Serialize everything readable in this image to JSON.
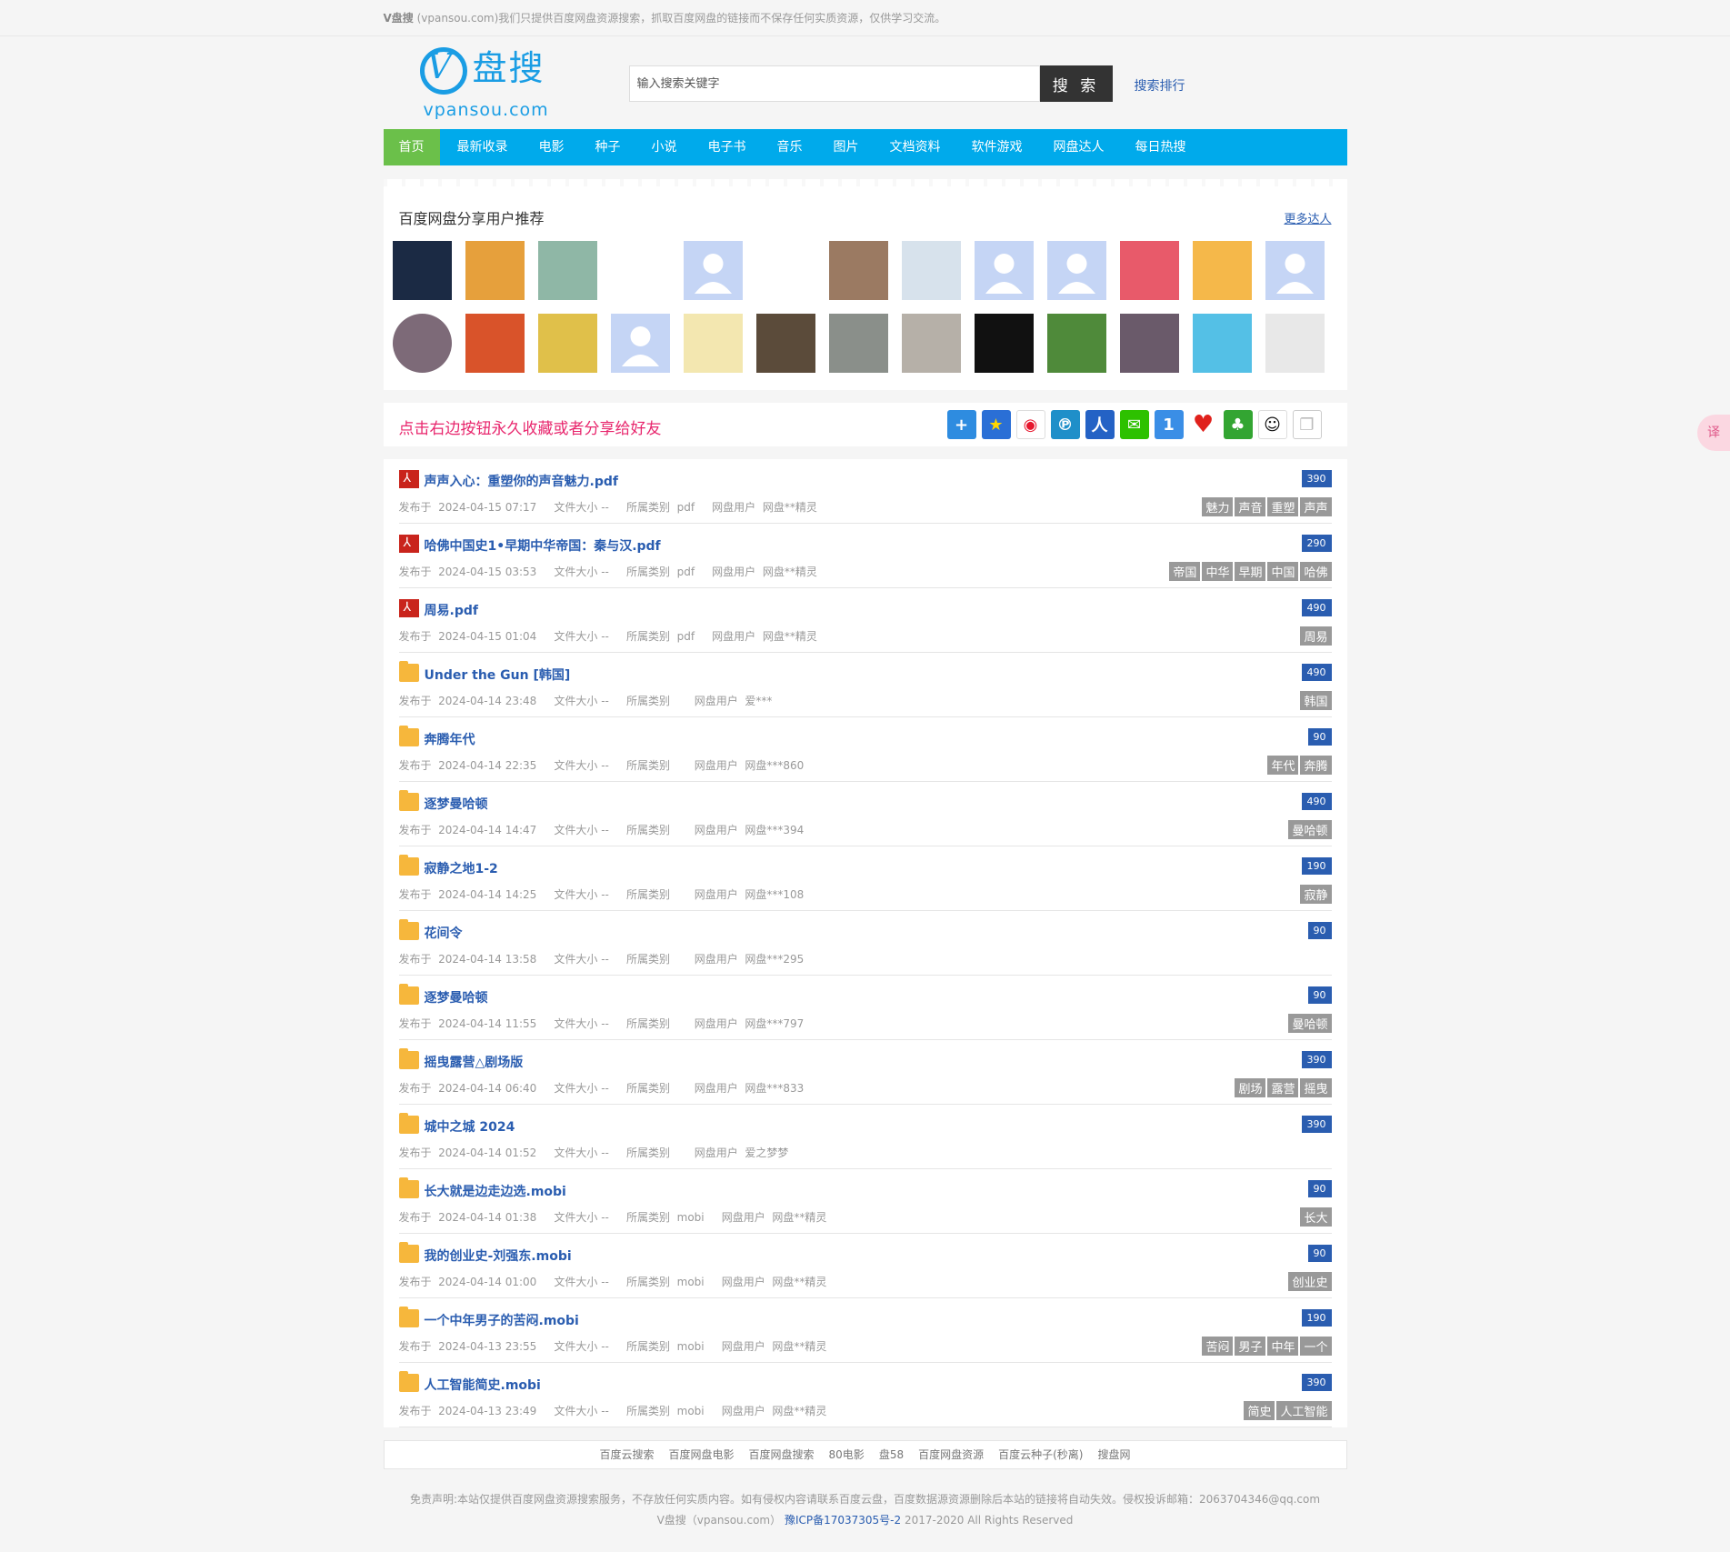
{
  "topbar": {
    "site": "V盘搜",
    "text": " (vpansou.com)我们只提供百度网盘资源搜索，抓取百度网盘的链接而不保存任何实质资源，仅供学习交流。"
  },
  "logo": {
    "v": "V",
    "cn": "盘搜",
    "en": "vpansou.com"
  },
  "search": {
    "placeholder": "输入搜索关键字",
    "button": "搜 索",
    "rank": "搜索排行"
  },
  "nav": [
    "首页",
    "最新收录",
    "电影",
    "种子",
    "小说",
    "电子书",
    "音乐",
    "图片",
    "文档资料",
    "软件游戏",
    "网盘达人",
    "每日热搜"
  ],
  "users": {
    "title": "百度网盘分享用户推荐",
    "more": "更多达人"
  },
  "share": {
    "text": "点击右边按钮永久收藏或者分享给好友"
  },
  "items": [
    {
      "type": "pdf",
      "title": "声声入心：重塑你的声音魅力.pdf",
      "date": "2024-04-15 07:17",
      "size": "--",
      "cat": "pdf",
      "user": "网盘**精灵",
      "score": "390",
      "tags": [
        "魅力",
        "声音",
        "重塑",
        "声声"
      ]
    },
    {
      "type": "pdf",
      "title": "哈佛中国史1•早期中华帝国：秦与汉.pdf",
      "date": "2024-04-15 03:53",
      "size": "--",
      "cat": "pdf",
      "user": "网盘**精灵",
      "score": "290",
      "tags": [
        "帝国",
        "中华",
        "早期",
        "中国",
        "哈佛"
      ]
    },
    {
      "type": "pdf",
      "title": "周易.pdf",
      "date": "2024-04-15 01:04",
      "size": "--",
      "cat": "pdf",
      "user": "网盘**精灵",
      "score": "490",
      "tags": [
        "周易"
      ]
    },
    {
      "type": "folder",
      "title": "Under the Gun [韩国]",
      "date": "2024-04-14 23:48",
      "size": "--",
      "cat": "",
      "user": "爱***",
      "score": "490",
      "tags": [
        "韩国"
      ]
    },
    {
      "type": "folder",
      "title": "奔腾年代",
      "date": "2024-04-14 22:35",
      "size": "--",
      "cat": "",
      "user": "网盘***860",
      "score": "90",
      "tags": [
        "年代",
        "奔腾"
      ]
    },
    {
      "type": "folder",
      "title": "逐梦曼哈顿",
      "date": "2024-04-14 14:47",
      "size": "--",
      "cat": "",
      "user": "网盘***394",
      "score": "490",
      "tags": [
        "曼哈顿"
      ]
    },
    {
      "type": "folder",
      "title": "寂静之地1-2",
      "date": "2024-04-14 14:25",
      "size": "--",
      "cat": "",
      "user": "网盘***108",
      "score": "190",
      "tags": [
        "寂静"
      ]
    },
    {
      "type": "folder",
      "title": "花间令",
      "date": "2024-04-14 13:58",
      "size": "--",
      "cat": "",
      "user": "网盘***295",
      "score": "90",
      "tags": []
    },
    {
      "type": "folder",
      "title": "逐梦曼哈顿",
      "date": "2024-04-14 11:55",
      "size": "--",
      "cat": "",
      "user": "网盘***797",
      "score": "90",
      "tags": [
        "曼哈顿"
      ]
    },
    {
      "type": "folder",
      "title": "摇曳露营△剧场版",
      "date": "2024-04-14 06:40",
      "size": "--",
      "cat": "",
      "user": "网盘***833",
      "score": "390",
      "tags": [
        "剧场",
        "露营",
        "摇曳"
      ]
    },
    {
      "type": "folder",
      "title": "城中之城 2024",
      "date": "2024-04-14 01:52",
      "size": "--",
      "cat": "",
      "user": "爱之梦梦",
      "score": "390",
      "tags": []
    },
    {
      "type": "folder",
      "title": "长大就是边走边选.mobi",
      "date": "2024-04-14 01:38",
      "size": "--",
      "cat": "mobi",
      "user": "网盘**精灵",
      "score": "90",
      "tags": [
        "长大"
      ]
    },
    {
      "type": "folder",
      "title": "我的创业史-刘强东.mobi",
      "date": "2024-04-14 01:00",
      "size": "--",
      "cat": "mobi",
      "user": "网盘**精灵",
      "score": "90",
      "tags": [
        "创业史"
      ]
    },
    {
      "type": "folder",
      "title": "一个中年男子的苦闷.mobi",
      "date": "2024-04-13 23:55",
      "size": "--",
      "cat": "mobi",
      "user": "网盘**精灵",
      "score": "190",
      "tags": [
        "苦闷",
        "男子",
        "中年",
        "一个"
      ]
    },
    {
      "type": "folder",
      "title": "人工智能简史.mobi",
      "date": "2024-04-13 23:49",
      "size": "--",
      "cat": "mobi",
      "user": "网盘**精灵",
      "score": "390",
      "tags": [
        "简史",
        "人工智能"
      ]
    }
  ],
  "labels": {
    "date": "发布于",
    "size": "文件大小",
    "cat": "所属类别",
    "user": "网盘用户"
  },
  "friends": [
    "百度云搜索",
    "百度网盘电影",
    "百度网盘搜索",
    "80电影",
    "盘58",
    "百度网盘资源",
    "百度云种子(秒离)",
    "搜盘网"
  ],
  "footer": {
    "disclaimer": "免责声明:本站仅提供百度网盘资源搜索服务，不存放任何实质内容。如有侵权内容请联系百度云盘，百度数据源资源删除后本站的链接将自动失效。侵权投诉邮箱：2063704346@qq.com",
    "site": "V盘搜（vpansou.com）",
    "icp": "豫ICP备17037305号-2",
    "copyright": "2017-2020 All Rights Reserved"
  },
  "translate": "译"
}
